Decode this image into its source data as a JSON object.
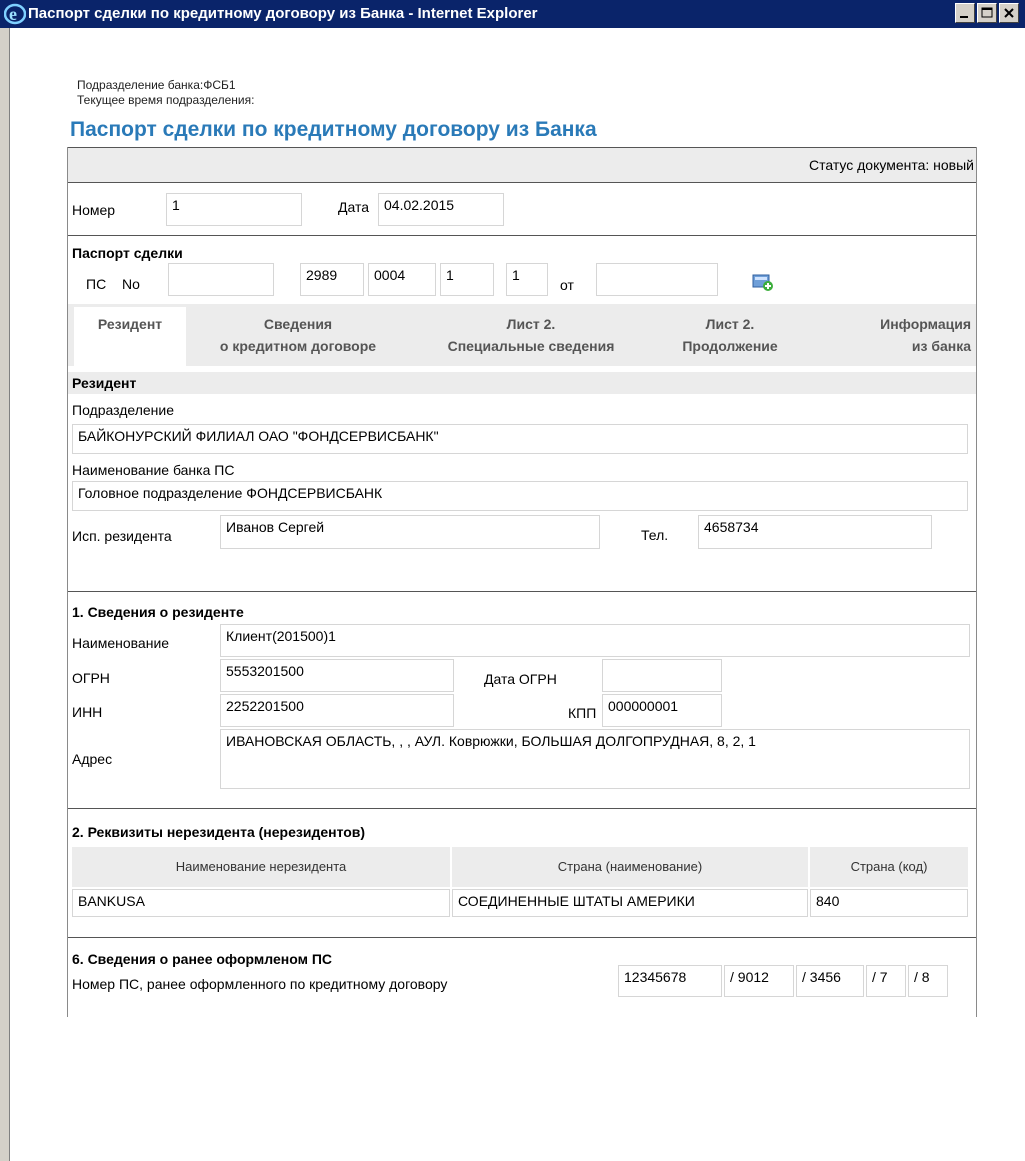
{
  "window": {
    "title": "Паспорт сделки по кредитному договору из Банка - Internet Explorer"
  },
  "header": {
    "division_line": "Подразделение банка:ФСБ1",
    "time_line": "Текущее время подразделения:",
    "page_title": "Паспорт сделки по кредитному договору из Банка"
  },
  "status": "Статус документа: новый",
  "number_block": {
    "number_label": "Номер",
    "number_value": "1",
    "date_label": "Дата",
    "date_value": "04.02.2015"
  },
  "passport": {
    "heading": "Паспорт сделки",
    "ps_label": "ПС",
    "no_label": "No",
    "no_value": "",
    "part2": "2989",
    "part3": "0004",
    "part4": "1",
    "part5": "1",
    "from_label": "от",
    "from_value": "",
    "add_icon": "add-document-icon"
  },
  "tabs": [
    {
      "label": "Резидент",
      "active": true
    },
    {
      "label": "Сведения\nо кредитном договоре",
      "active": false
    },
    {
      "label": "Лист 2.\nСпециальные сведения",
      "active": false
    },
    {
      "label": "Лист 2.\nПродолжение",
      "active": false
    },
    {
      "label": "Информация\nиз банка",
      "active": false
    }
  ],
  "resident": {
    "section_header": "Резидент",
    "division_label": "Подразделение",
    "division_value": "БАЙКОНУРСКИЙ ФИЛИАЛ ОАО \"ФОНДСЕРВИСБАНК\"",
    "bank_label": "Наименование банка ПС",
    "bank_value": "Головное подразделение ФОНДСЕРВИСБАНК",
    "executor_label": "Исп. резидента",
    "executor_value": "Иванов Сергей",
    "phone_label": "Тел.",
    "phone_value": "4658734"
  },
  "section1": {
    "heading": "1. Сведения о резиденте",
    "name_label": "Наименование",
    "name_value": "Клиент(201500)1",
    "ogrn_label": "ОГРН",
    "ogrn_value": "5553201500",
    "ogrn_date_label": "Дата ОГРН",
    "ogrn_date_value": "",
    "inn_label": "ИНН",
    "inn_value": "2252201500",
    "kpp_label": "КПП",
    "kpp_value": "000000001",
    "address_label": "Адрес",
    "address_value": "ИВАНОВСКАЯ ОБЛАСТЬ, , , АУЛ. Коврюжки, БОЛЬШАЯ ДОЛГОПРУДНАЯ, 8, 2, 1"
  },
  "section2": {
    "heading": "2. Реквизиты нерезидента (нерезидентов)",
    "columns": [
      "Наименование нерезидента",
      "Страна (наименование)",
      "Страна (код)"
    ],
    "rows": [
      [
        "BANKUSA",
        "СОЕДИНЕННЫЕ ШТАТЫ АМЕРИКИ",
        "840"
      ]
    ]
  },
  "section6": {
    "heading": "6. Сведения о ранее оформленом ПС",
    "label": "Номер ПС, ранее оформленного по кредитному договору",
    "p1": "12345678",
    "p2": "/ 9012",
    "p3": "/ 3456",
    "p4": "/ 7",
    "p5": "/ 8"
  }
}
